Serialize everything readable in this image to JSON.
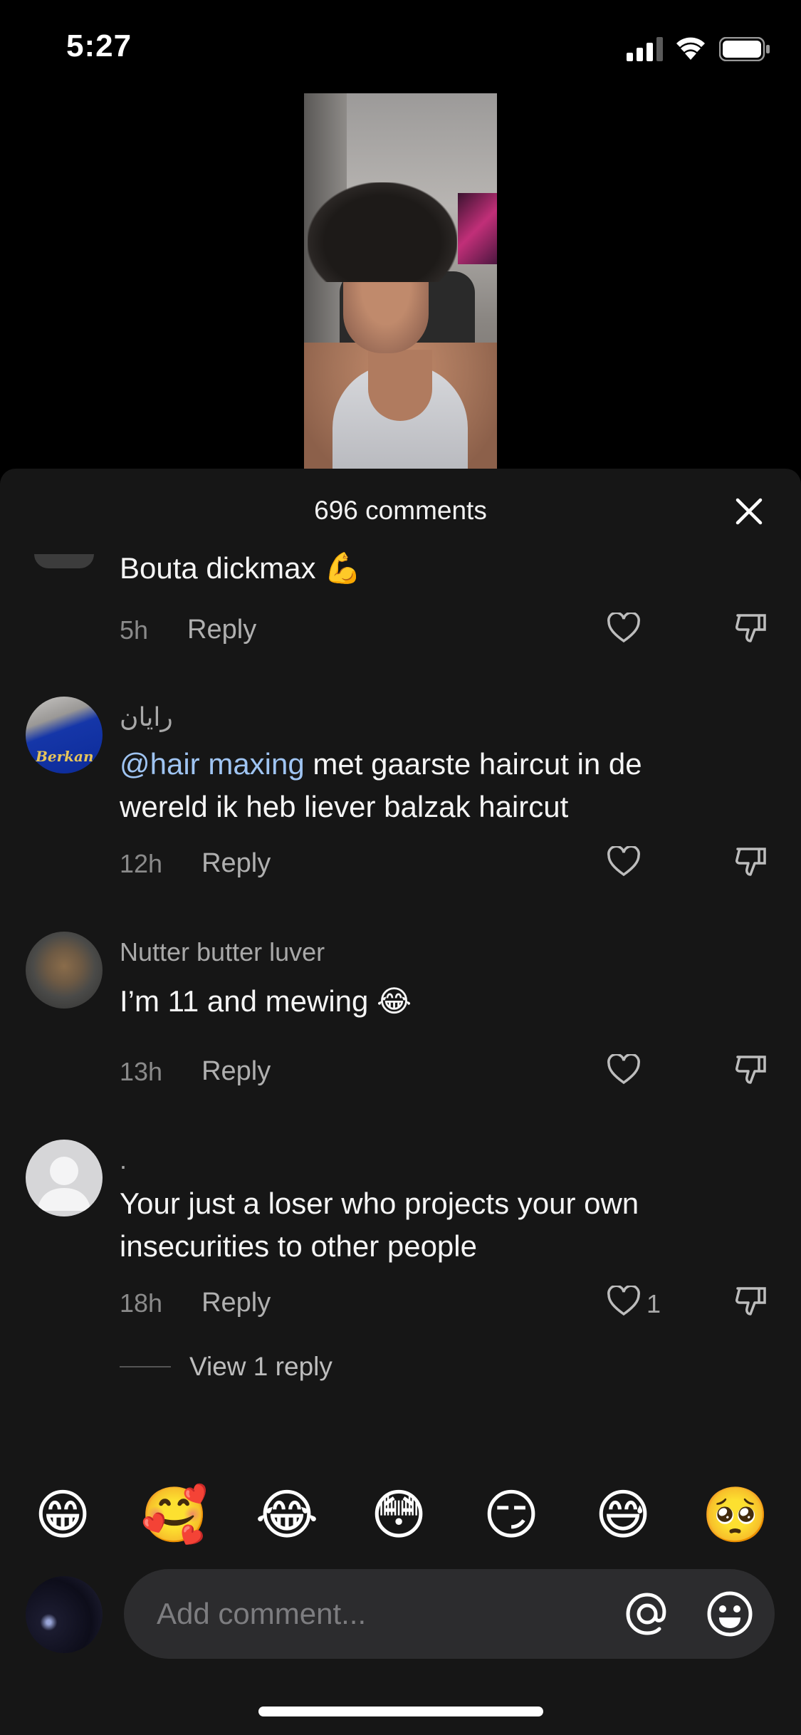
{
  "status_bar": {
    "time": "5:27"
  },
  "sheet": {
    "title": "696 comments"
  },
  "comments": [
    {
      "username": "",
      "text": "Bouta dickmax 💪",
      "time": "5h",
      "reply_label": "Reply",
      "likes": ""
    },
    {
      "username": "رايان",
      "mention": "@hair maxing",
      "text": " met gaarste haircut in de wereld ik heb liever balzak haircut",
      "time": "12h",
      "reply_label": "Reply",
      "likes": "",
      "avatar_text": "Berkan"
    },
    {
      "username": "Nutter butter luver",
      "text": "I’m 11 and mewing 😂",
      "time": "13h",
      "reply_label": "Reply",
      "likes": ""
    },
    {
      "username": ".",
      "text": "Your just a loser who projects your own insecurities to other people",
      "time": "18h",
      "reply_label": "Reply",
      "likes": "1"
    }
  ],
  "view_replies": "View 1 reply",
  "quick_emojis": [
    "😁",
    "🥰",
    "😂",
    "😳",
    "😏",
    "😅",
    "🥺"
  ],
  "composer": {
    "placeholder": "Add comment..."
  },
  "icons": {
    "close": "close-icon",
    "like": "heart-icon",
    "dislike": "thumbs-down-icon",
    "mention": "at-icon",
    "emoji": "smiley-icon"
  }
}
